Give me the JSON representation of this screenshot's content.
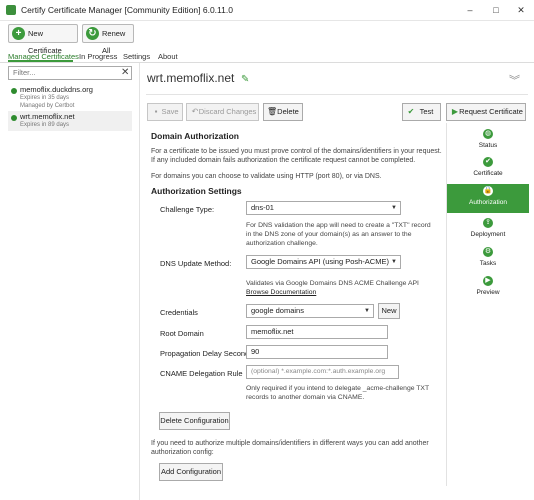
{
  "window": {
    "title": "Certify Certificate Manager [Community Edition] 6.0.11.0",
    "minimize": "–",
    "maximize": "□",
    "close": "✕"
  },
  "toolbar": {
    "new_certificate": "New Certificate",
    "renew_all": "Renew All"
  },
  "tabs": [
    "Managed Certificates",
    "In Progress",
    "Settings",
    "About"
  ],
  "filter": {
    "placeholder": "Filter...",
    "clear": "✕"
  },
  "sites": [
    {
      "name": "memoflix.duckdns.org",
      "expires": "Expires in 35 days",
      "managed": "Managed by Certbot"
    },
    {
      "name": "wrt.memoflix.net",
      "expires": "Expires in 89 days"
    }
  ],
  "header": {
    "domain": "wrt.memoflix.net"
  },
  "actions": {
    "save": "Save",
    "discard": "Discard Changes",
    "delete": "Delete",
    "test": "Test",
    "request": "Request Certificate"
  },
  "domain_auth": {
    "title": "Domain Authorization",
    "para1_line1": "For a certificate to be issued you must prove control of the domains/identifiers in your request.",
    "para1_line2": "If any included domain fails authorization the certificate request cannot be completed.",
    "para2": "For domains you can choose to validate using HTTP (port 80), or via DNS."
  },
  "auth_settings": {
    "title": "Authorization Settings",
    "challenge_label": "Challenge Type:",
    "challenge_value": "dns-01",
    "challenge_hint": [
      "For DNS validation the app will need to create a \"TXT\" record",
      "in the DNS zone of your domain(s) as an answer to the",
      "authorization challenge."
    ],
    "dns_label": "DNS Update Method:",
    "dns_value": "Google Domains API (using Posh-ACME)",
    "dns_hint": "Validates via Google Domains DNS ACME Challenge API",
    "browse_doc": "Browse Documentation",
    "credentials_label": "Credentials",
    "credentials_value": "google domains",
    "new_button": "New",
    "root_domain_label": "Root Domain",
    "root_domain_value": "memoflix.net",
    "propagation_label": "Propagation Delay Seconds",
    "propagation_value": "90",
    "cname_label": "CNAME Delegation Rule",
    "cname_placeholder": "(optional) *.example.com:*.auth.example.org",
    "cname_hint": [
      "Only required if you intend to delegate _acme-challenge TXT",
      "records to another domain via CNAME."
    ],
    "delete_config": "Delete Configuration",
    "multi_line1": "If you need to authorize multiple domains/identifiers in different ways you can add another",
    "multi_line2": "authorization config:",
    "add_config": "Add Configuration"
  },
  "sidenav": [
    "Status",
    "Certificate",
    "Authorization",
    "Deployment",
    "Tasks",
    "Preview"
  ],
  "colors": {
    "accent": "#3c9a3c",
    "active_nav": "#3c9a3c"
  }
}
